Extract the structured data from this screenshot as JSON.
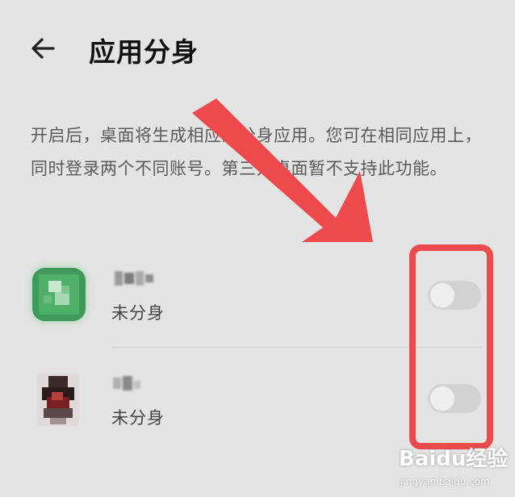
{
  "header": {
    "title": "应用分身"
  },
  "description": "开启后，桌面将生成相应的分身应用。您可在相同应用上，同时登录两个不同账号。第三方桌面暂不支持此功能。",
  "apps": [
    {
      "status": "未分身",
      "enabled": false
    },
    {
      "status": "未分身",
      "enabled": false
    }
  ],
  "watermark": {
    "logo": "Baidu经验",
    "url": "jingyan.baidu.com"
  },
  "colors": {
    "background": "#e4e4e4",
    "annotation": "#ec4a4c",
    "toggle_off": "#d3d3d3"
  }
}
